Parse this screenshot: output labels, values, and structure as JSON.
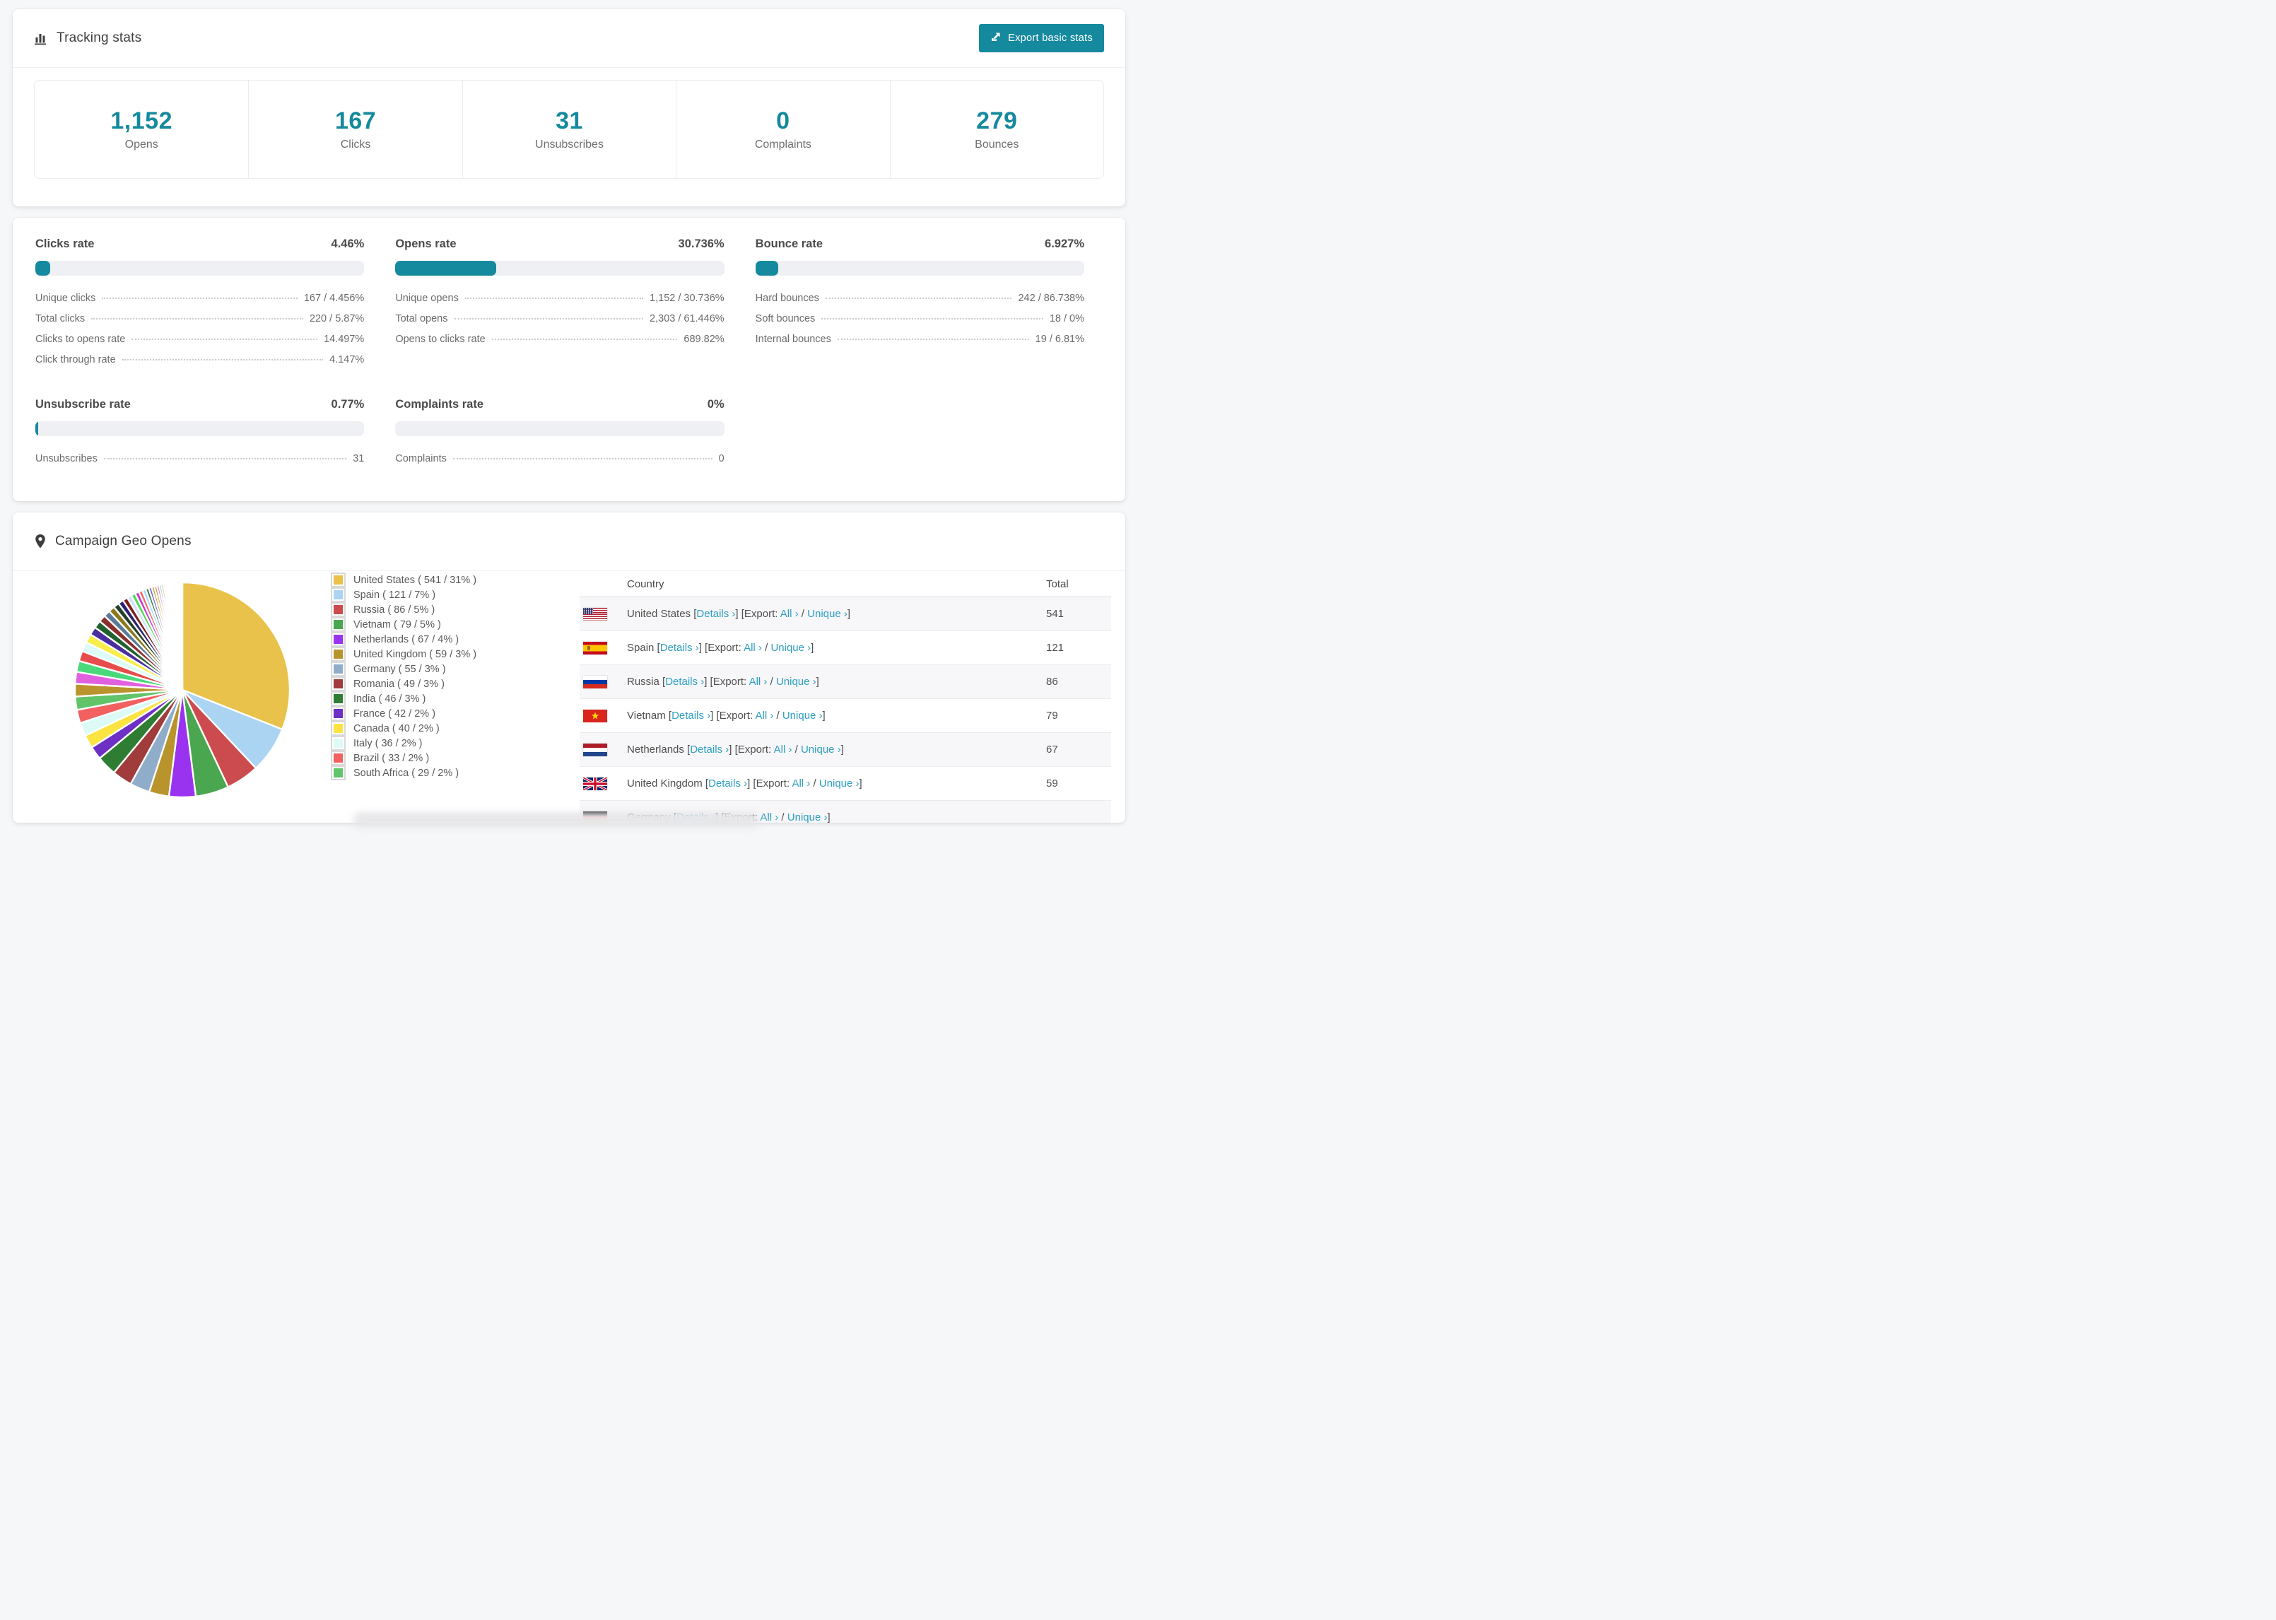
{
  "colors": {
    "accent": "#15899e",
    "link": "#2d9fc2",
    "bar_track": "#eef0f3",
    "swatch_border": "#d9d9d9"
  },
  "tracking": {
    "title": "Tracking stats",
    "export_button": "Export basic stats",
    "stats": [
      {
        "value": "1,152",
        "label": "Opens"
      },
      {
        "value": "167",
        "label": "Clicks"
      },
      {
        "value": "31",
        "label": "Unsubscribes"
      },
      {
        "value": "0",
        "label": "Complaints"
      },
      {
        "value": "279",
        "label": "Bounces"
      }
    ]
  },
  "rates": {
    "sections": [
      {
        "title": "Clicks rate",
        "value": "4.46%",
        "pct": 4.46,
        "rows": [
          [
            "Unique clicks",
            "167 / 4.456%"
          ],
          [
            "Total clicks",
            "220 / 5.87%"
          ],
          [
            "Clicks to opens rate",
            "14.497%"
          ],
          [
            "Click through rate",
            "4.147%"
          ]
        ]
      },
      {
        "title": "Opens rate",
        "value": "30.736%",
        "pct": 30.736,
        "rows": [
          [
            "Unique opens",
            "1,152 / 30.736%"
          ],
          [
            "Total opens",
            "2,303 / 61.446%"
          ],
          [
            "Opens to clicks rate",
            "689.82%"
          ]
        ]
      },
      {
        "title": "Bounce rate",
        "value": "6.927%",
        "pct": 6.927,
        "rows": [
          [
            "Hard bounces",
            "242 / 86.738%"
          ],
          [
            "Soft bounces",
            "18 / 0%"
          ],
          [
            "Internal bounces",
            "19 / 6.81%"
          ]
        ]
      },
      {
        "title": "Unsubscribe rate",
        "value": "0.77%",
        "pct": 0.77,
        "rows": [
          [
            "Unsubscribes",
            "31"
          ]
        ]
      },
      {
        "title": "Complaints rate",
        "value": "0%",
        "pct": 0,
        "rows": [
          [
            "Complaints",
            "0"
          ]
        ]
      }
    ]
  },
  "geo": {
    "title": "Campaign Geo Opens",
    "legend": [
      {
        "name": "United States",
        "total": "541",
        "pct": "31",
        "color": "#e8c24a",
        "flag": "us"
      },
      {
        "name": "Spain",
        "total": "121",
        "pct": "7",
        "color": "#abd3f2",
        "flag": "es"
      },
      {
        "name": "Russia",
        "total": "86",
        "pct": "5",
        "color": "#cc4b4e",
        "flag": "ru"
      },
      {
        "name": "Vietnam",
        "total": "79",
        "pct": "5",
        "color": "#4aa64f",
        "flag": "vn"
      },
      {
        "name": "Netherlands",
        "total": "67",
        "pct": "4",
        "color": "#9a33f0",
        "flag": "nl"
      },
      {
        "name": "United Kingdom",
        "total": "59",
        "pct": "3",
        "color": "#b9942d",
        "flag": "gb"
      },
      {
        "name": "Germany",
        "total": "55",
        "pct": "3",
        "color": "#8fadc9",
        "flag": "de"
      },
      {
        "name": "Romania",
        "total": "49",
        "pct": "3",
        "color": "#a03c3c",
        "flag": "ro"
      },
      {
        "name": "India",
        "total": "46",
        "pct": "3",
        "color": "#2f7d33",
        "flag": "in"
      },
      {
        "name": "France",
        "total": "42",
        "pct": "2",
        "color": "#6d2fc4",
        "flag": "fr"
      },
      {
        "name": "Canada",
        "total": "40",
        "pct": "2",
        "color": "#fbe342",
        "flag": "ca"
      },
      {
        "name": "Italy",
        "total": "36",
        "pct": "2",
        "color": "#dcfbf6",
        "flag": "it"
      },
      {
        "name": "Brazil",
        "total": "33",
        "pct": "2",
        "color": "#f26060",
        "flag": "br"
      },
      {
        "name": "South Africa",
        "total": "29",
        "pct": "2",
        "color": "#62c469",
        "flag": "za"
      }
    ],
    "table": {
      "columns": [
        "Country",
        "Total"
      ],
      "link_labels": {
        "details": "Details ›",
        "export": "Export:",
        "all": "All ›",
        "unique": "Unique ›"
      },
      "rows": [
        {
          "country": "United States",
          "flag": "us",
          "total": "541"
        },
        {
          "country": "Spain",
          "flag": "es",
          "total": "121"
        },
        {
          "country": "Russia",
          "flag": "ru",
          "total": "86"
        },
        {
          "country": "Vietnam",
          "flag": "vn",
          "total": "79"
        },
        {
          "country": "Netherlands",
          "flag": "nl",
          "total": "67"
        },
        {
          "country": "United Kingdom",
          "flag": "gb",
          "total": "59"
        },
        {
          "country": "Germany",
          "flag": "de",
          "total": "",
          "partial": true
        }
      ]
    }
  },
  "chart_data": {
    "type": "pie",
    "title": "Campaign Geo Opens",
    "legend_position": "right",
    "categories": [
      "United States",
      "Spain",
      "Russia",
      "Vietnam",
      "Netherlands",
      "United Kingdom",
      "Germany",
      "Romania",
      "India",
      "France",
      "Canada",
      "Italy",
      "Brazil",
      "South Africa"
    ],
    "values": [
      541,
      121,
      86,
      79,
      67,
      59,
      55,
      49,
      46,
      42,
      40,
      36,
      33,
      29
    ],
    "percents": [
      31,
      7,
      5,
      5,
      4,
      3,
      3,
      3,
      3,
      2,
      2,
      2,
      2,
      2
    ],
    "colors": [
      "#e8c24a",
      "#abd3f2",
      "#cc4b4e",
      "#4aa64f",
      "#9a33f0",
      "#b9942d",
      "#8fadc9",
      "#a03c3c",
      "#2f7d33",
      "#6d2fc4",
      "#fbe342",
      "#dcfbf6",
      "#f26060",
      "#62c469"
    ],
    "start_angle_deg": 0,
    "direction": "clockwise",
    "unlabeled_tail_pct": 26,
    "note": "Remaining ~26% is drawn as many thin unlabeled country slices separated by white gaps"
  }
}
